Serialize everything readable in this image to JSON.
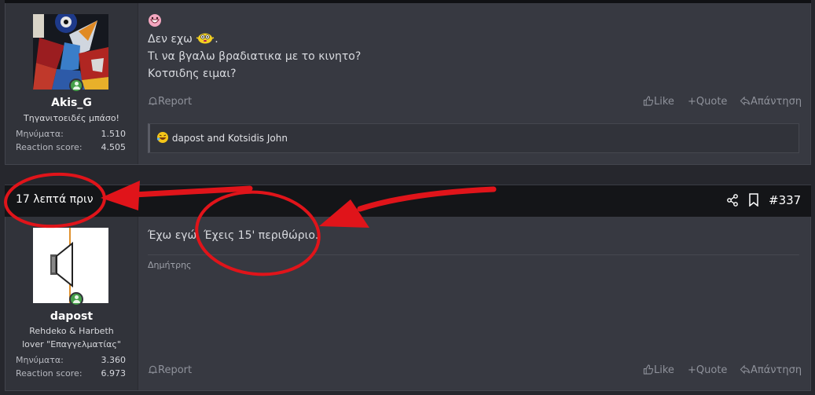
{
  "posts": [
    {
      "author": {
        "username": "Akis_G",
        "title": "Τηγανιτοειδές μπάσο!",
        "stats": [
          {
            "label": "Μηνύματα:",
            "value": "1.510"
          },
          {
            "label": "Reaction score:",
            "value": "4.505"
          }
        ]
      },
      "message_lines": [
        "Δεν εχω",
        ".",
        "Τι να βγαλω βραδιατικα με το κινητο?",
        "Κοτσιδης ειμαι?"
      ],
      "reactions": "dapost and Kotsidis John"
    },
    {
      "header": {
        "time": "17 λεπτά πριν",
        "post_number": "#337"
      },
      "author": {
        "username": "dapost",
        "title_lines": [
          "Rehdeko & Harbeth",
          "lover \"Επαγγελματίας\""
        ],
        "stats": [
          {
            "label": "Μηνύματα:",
            "value": "3.360"
          },
          {
            "label": "Reaction score:",
            "value": "6.973"
          }
        ]
      },
      "message": "Έχω εγώ. Έχεις 15' περιθώριο.",
      "signature": "Δημήτρης"
    }
  ],
  "actions": {
    "report": "Report",
    "like": "Like",
    "quote": "Quote",
    "reply": "Απάντηση"
  },
  "colors": {
    "annotation_red": "#e0141a",
    "online_green": "#46a04a"
  }
}
